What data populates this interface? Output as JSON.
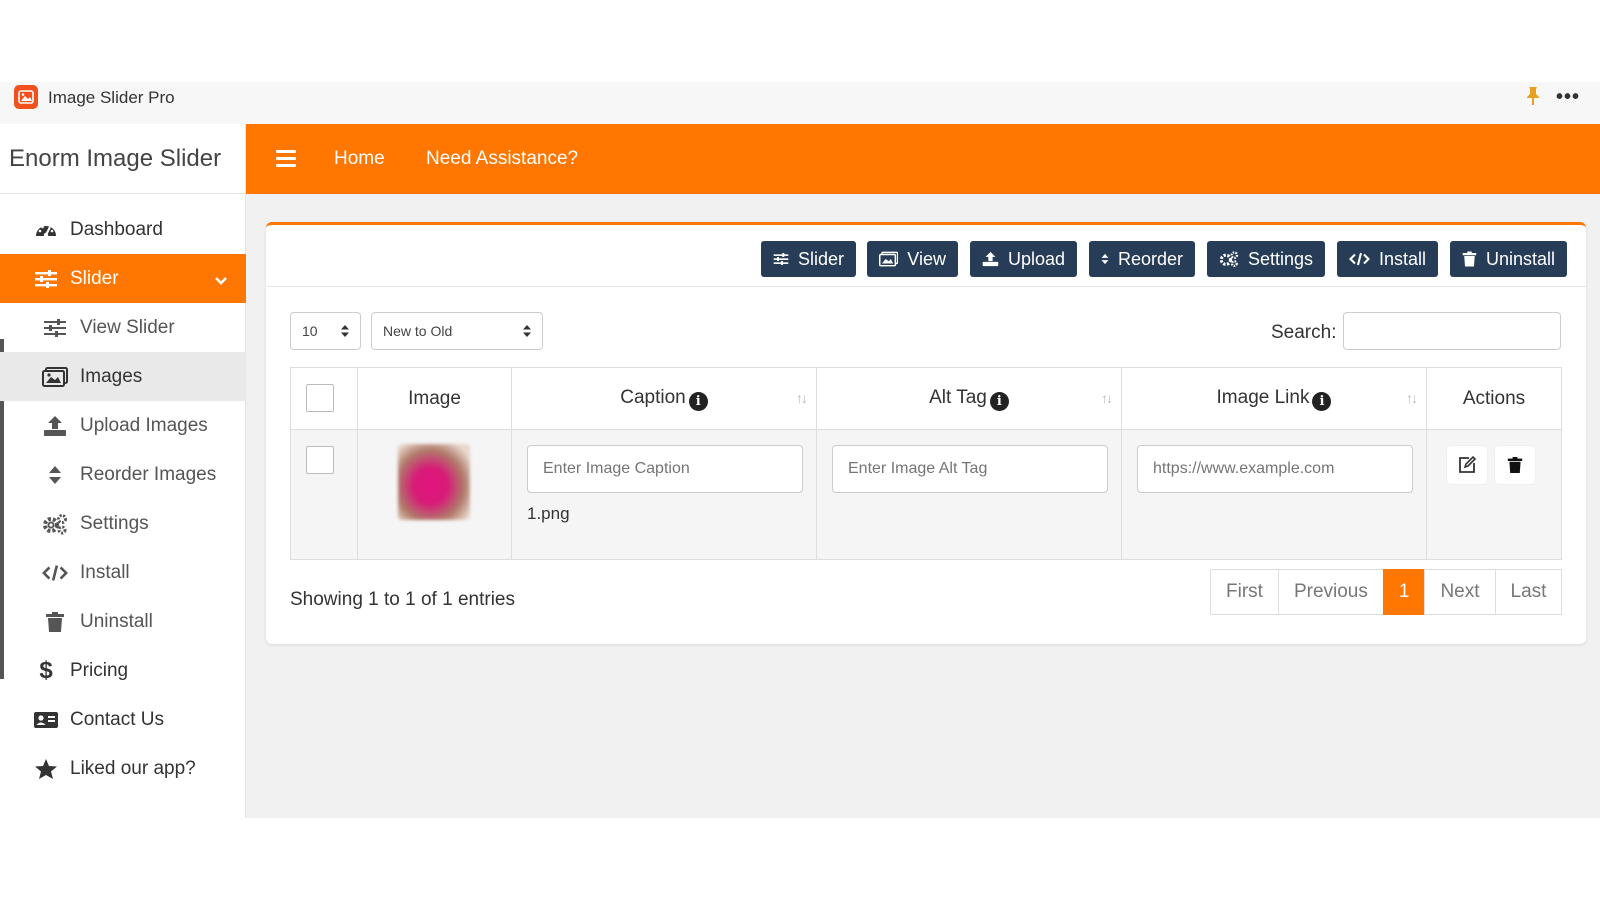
{
  "app": {
    "title": "Image Slider Pro",
    "brand": "Enorm Image Slider"
  },
  "sidebar": {
    "items": [
      {
        "label": "Dashboard",
        "icon": "gauge-icon"
      },
      {
        "label": "Slider",
        "icon": "sliders-icon"
      },
      {
        "label": "View Slider",
        "icon": "sliders-icon"
      },
      {
        "label": "Images",
        "icon": "images-icon"
      },
      {
        "label": "Upload Images",
        "icon": "upload-icon"
      },
      {
        "label": "Reorder Images",
        "icon": "sort-icon"
      },
      {
        "label": "Settings",
        "icon": "gears-icon"
      },
      {
        "label": "Install",
        "icon": "code-icon"
      },
      {
        "label": "Uninstall",
        "icon": "trash-icon"
      },
      {
        "label": "Pricing",
        "icon": "dollar-icon"
      },
      {
        "label": "Contact Us",
        "icon": "address-card-icon"
      },
      {
        "label": "Liked our app?",
        "icon": "star-icon"
      }
    ]
  },
  "header": {
    "home": "Home",
    "assist": "Need Assistance?"
  },
  "toolbar": {
    "slider": "Slider",
    "view": "View",
    "upload": "Upload",
    "reorder": "Reorder",
    "settings": "Settings",
    "install": "Install",
    "uninstall": "Uninstall"
  },
  "controls": {
    "page_size": "10",
    "sort": "New to Old",
    "search_label": "Search:",
    "search_value": ""
  },
  "table": {
    "columns": [
      "Image",
      "Caption",
      "Alt Tag",
      "Image Link",
      "Actions"
    ],
    "rows": [
      {
        "caption_placeholder": "Enter Image Caption",
        "alt_placeholder": "Enter Image Alt Tag",
        "link_placeholder": "https://www.example.com",
        "filename": "1.png"
      }
    ]
  },
  "footer": {
    "showing": "Showing 1 to 1 of 1 entries",
    "pager": {
      "first": "First",
      "previous": "Previous",
      "current": "1",
      "next": "Next",
      "last": "Last"
    }
  },
  "colors": {
    "accent": "#ff7600",
    "toolbar_button": "#263c57",
    "app_icon": "#f2511d"
  }
}
